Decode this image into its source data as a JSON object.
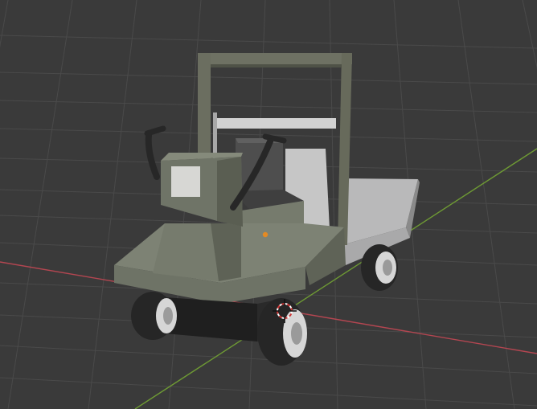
{
  "viewport": {
    "background": "#3a3a3a",
    "grid_color": "#4a4a4a",
    "x_axis_color": "#b44651",
    "y_axis_color": "#6e9a34"
  },
  "scene": {
    "object": "utility cart",
    "body_color": "#6e7466",
    "bed_color": "#b7b8b8",
    "frame_color": "#6a6d5e",
    "tire_color": "#2a2a2a",
    "rim_color": "#d8d8d8",
    "origin_dot_color": "#e38a24",
    "cursor_ring_colors": [
      "#cc3333",
      "#ffffff"
    ]
  }
}
